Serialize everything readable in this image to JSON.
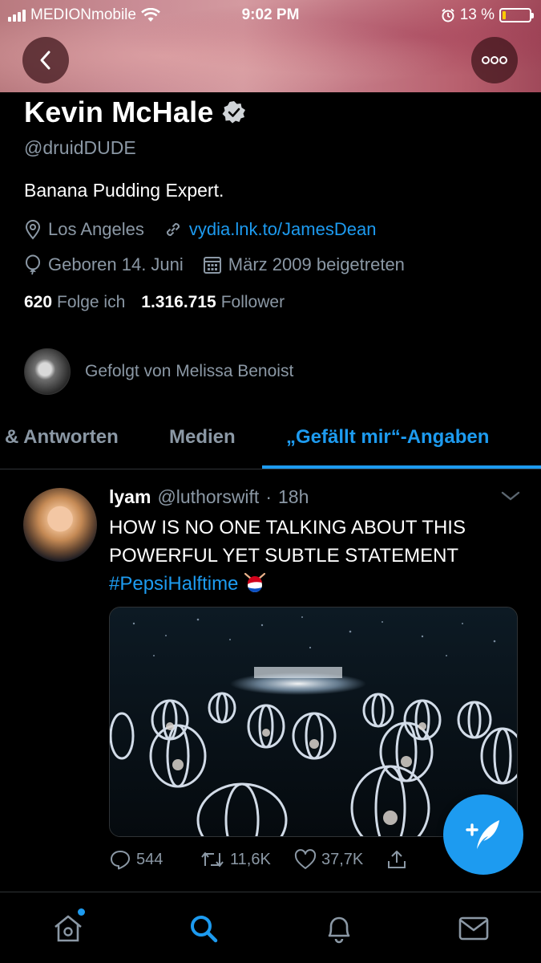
{
  "status_bar": {
    "carrier": "MEDIONmobile",
    "time": "9:02 PM",
    "battery": "13 %",
    "battery_level": 0.13
  },
  "profile": {
    "name": "Kevin McHale",
    "verified": true,
    "handle": "@druidDUDE",
    "bio": "Banana Pudding Expert.",
    "location": "Los Angeles",
    "website": "vydia.lnk.to/JamesDean",
    "birthday": "Geboren 14. Juni",
    "joined": "März 2009 beigetreten",
    "following_count": "620",
    "following_label": "Folge ich",
    "followers_count": "1.316.715",
    "followers_label": "Follower",
    "followed_by": "Gefolgt von Melissa Benoist"
  },
  "tabs": [
    {
      "label": "& Antworten",
      "active": false
    },
    {
      "label": "Medien",
      "active": false
    },
    {
      "label": "„Gefällt mir“-Angaben",
      "active": true
    }
  ],
  "tweet": {
    "author_name": "lyam",
    "author_handle": "@luthorswift",
    "time_sep": "·",
    "time": "18h",
    "text": "HOW IS NO ONE TALKING ABOUT THIS POWERFUL YET SUBTLE STATEMENT",
    "hashtag": "#PepsiHalftime",
    "replies": "544",
    "retweets": "11,6K",
    "likes": "37,7K"
  },
  "colors": {
    "accent": "#1d9bf0",
    "secondary_text": "#8b98a5",
    "background": "#000000"
  },
  "icons": {
    "back": "chevron-left-icon",
    "more": "more-dots-icon",
    "verified": "verified-badge-icon",
    "location": "location-pin-icon",
    "link": "link-icon",
    "birthday": "balloon-icon",
    "calendar": "calendar-icon",
    "reply": "reply-icon",
    "retweet": "retweet-icon",
    "like": "heart-icon",
    "share": "share-icon",
    "compose": "compose-tweet-icon",
    "home": "home-icon",
    "search": "search-icon",
    "notifications": "bell-icon",
    "messages": "mail-icon"
  }
}
